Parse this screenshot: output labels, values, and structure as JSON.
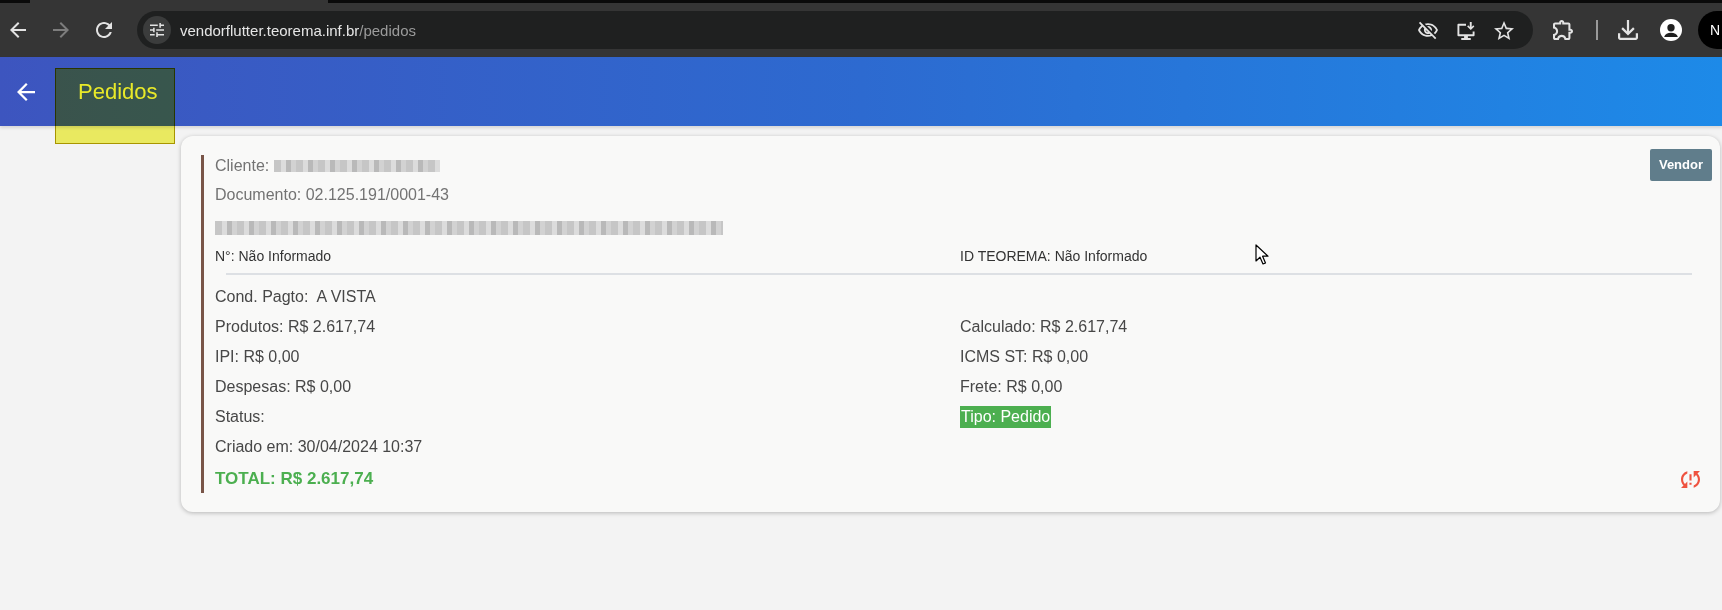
{
  "browser": {
    "nav_buttons": [
      {
        "kind": "back",
        "disabled": false
      },
      {
        "kind": "forward",
        "disabled": true
      },
      {
        "kind": "reload",
        "disabled": false
      }
    ],
    "url": {
      "host": "vendorflutter.teorema.inf.br",
      "path": "/pedidos"
    },
    "profile_initial": "N"
  },
  "app_bar": {
    "title": "Pedidos",
    "highlighted": true
  },
  "order": {
    "badge": "Vendor",
    "client": {
      "label": "Cliente:",
      "redacted": true
    },
    "document": "Documento: 02.125.191/0001-43",
    "trade_name_redacted": true,
    "identifiers": [
      "N°: Não Informado",
      "ID TEOREMA: Não Informado"
    ],
    "rows": [
      {
        "left": {
          "kind": "text",
          "text": "Cond. Pagto:  A VISTA"
        }
      },
      {
        "left": {
          "kind": "text",
          "text": "Produtos: R$ 2.617,74"
        },
        "right": {
          "kind": "text",
          "text": "Calculado: R$ 2.617,74"
        }
      },
      {
        "left": {
          "kind": "text",
          "text": "IPI: R$ 0,00"
        },
        "right": {
          "kind": "text",
          "text": "ICMS ST: R$ 0,00"
        }
      },
      {
        "left": {
          "kind": "text",
          "text": "Despesas: R$ 0,00"
        },
        "right": {
          "kind": "text",
          "text": "Frete: R$ 0,00"
        }
      },
      {
        "left": {
          "kind": "text",
          "text": "Status:"
        },
        "right": {
          "kind": "tag",
          "text": "Tipo: Pedido"
        }
      },
      {
        "left": {
          "kind": "text",
          "text": "Criado em: 30/04/2024 10:37"
        }
      },
      {
        "left": {
          "kind": "total",
          "text": "TOTAL: R$ 2.617,74"
        }
      }
    ]
  }
}
